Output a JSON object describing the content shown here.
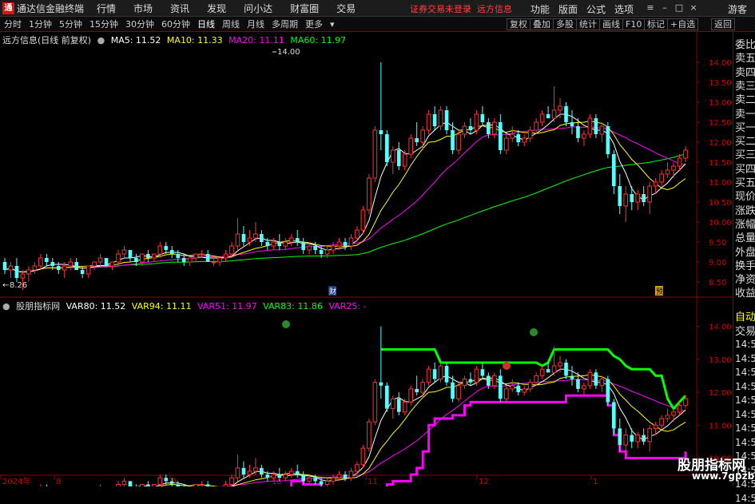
{
  "topbar": {
    "logo": "通",
    "app_title": "通达信金融终端",
    "menu": [
      "行情",
      "市场",
      "资讯",
      "发现",
      "问小达",
      "财富圈",
      "交易"
    ],
    "warning": "证券交易未登录",
    "warning_tail": "远方信息",
    "right_items": [
      "功能",
      "版面",
      "公式",
      "选项"
    ],
    "guest": "游客"
  },
  "toolbar": {
    "periods": [
      "分时",
      "1分钟",
      "5分钟",
      "15分钟",
      "30分钟",
      "60分钟",
      "日线",
      "周线",
      "月线",
      "多周期",
      "更多"
    ],
    "active_period": "日线",
    "buttons": [
      "复权",
      "叠加",
      "多股",
      "统计",
      "画线",
      "F10",
      "标记",
      "+自选",
      "返回"
    ]
  },
  "main_chart": {
    "title": "远方信息(日线 前复权)",
    "ma5": "MA5: 11.52",
    "ma10": "MA10: 11.33",
    "ma20": "MA20: 11.11",
    "ma60": "MA60: 11.97",
    "high_label": "14.00",
    "low_label": "8.26",
    "marker_cai": "财",
    "marker_yue": "预",
    "y_ticks": [
      "14.00",
      "13.50",
      "13.00",
      "12.50",
      "12.00",
      "11.50",
      "11.00",
      "10.50",
      "10.00",
      "9.50",
      "9.00",
      "8.50"
    ]
  },
  "sub_chart": {
    "title": "股朋指标网",
    "var80": "VAR80: 11.52",
    "var94": "VAR94: 11.11",
    "var51": "VAR51: 11.97",
    "var83": "VAR83: 11.86",
    "var25": "VAR25: -",
    "y_ticks": [
      "14.00",
      "13.00",
      "12.00",
      "11.00",
      "10.00"
    ]
  },
  "x_axis": [
    "2024年",
    "8",
    "9",
    "10",
    "11",
    "12",
    "1"
  ],
  "right_panel": {
    "top_items": [
      "委比",
      "卖五",
      "卖四",
      "卖三",
      "卖二",
      "卖一",
      "买一",
      "买二",
      "买三",
      "买四",
      "买五",
      "现价",
      "涨跌",
      "涨幅",
      "总量",
      "外盘",
      "换手",
      "净资",
      "收益"
    ],
    "bottom_head": [
      "自动",
      "交易"
    ],
    "time_rows": [
      "14:5",
      "14:5",
      "14:5",
      "14:5",
      "14:5",
      "14:5",
      "14:5",
      "14:5",
      "14:5",
      "14:5",
      "14:5",
      "14:5"
    ]
  },
  "watermark": {
    "line1": "股朋指标网",
    "line2": "www.7gpzb.com"
  },
  "colors": {
    "up": "#ff3232",
    "down": "#54ffff",
    "ma5": "#ffffff",
    "ma10": "#ffff00",
    "ma20": "#ff00ff",
    "ma60": "#00ff00",
    "var51": "#00ff00",
    "var83": "#ff00ff"
  },
  "chart_data": {
    "type": "candlestick",
    "title": "远方信息(日线 前复权)",
    "x_labels": [
      "2024年",
      "8",
      "9",
      "10",
      "11",
      "12",
      "1"
    ],
    "price_range": [
      8.26,
      14.0
    ],
    "main_ylim": [
      8.2,
      14.4
    ],
    "sub_ylim": [
      9.6,
      14.5
    ],
    "candles": [
      [
        9.0,
        9.1,
        8.7,
        8.8
      ],
      [
        8.8,
        9.0,
        8.6,
        8.9
      ],
      [
        8.9,
        9.1,
        8.5,
        8.6
      ],
      [
        8.6,
        8.8,
        8.3,
        8.7
      ],
      [
        8.7,
        8.9,
        8.5,
        8.8
      ],
      [
        8.8,
        9.0,
        8.7,
        8.9
      ],
      [
        8.9,
        9.2,
        8.8,
        9.1
      ],
      [
        9.1,
        9.2,
        8.9,
        9.0
      ],
      [
        9.0,
        9.1,
        8.8,
        8.9
      ],
      [
        8.9,
        9.0,
        8.7,
        8.8
      ],
      [
        8.8,
        9.0,
        8.6,
        8.9
      ],
      [
        8.9,
        9.1,
        8.8,
        9.0
      ],
      [
        9.0,
        9.1,
        8.8,
        8.8
      ],
      [
        8.8,
        8.9,
        8.6,
        8.7
      ],
      [
        8.7,
        8.9,
        8.6,
        8.9
      ],
      [
        8.9,
        9.0,
        8.8,
        9.0
      ],
      [
        9.0,
        9.2,
        8.9,
        9.1
      ],
      [
        9.1,
        9.1,
        8.9,
        8.9
      ],
      [
        8.9,
        9.0,
        8.8,
        9.0
      ],
      [
        9.0,
        9.3,
        8.9,
        9.2
      ],
      [
        9.2,
        9.4,
        9.1,
        9.3
      ],
      [
        9.3,
        9.3,
        9.0,
        9.1
      ],
      [
        9.1,
        9.2,
        8.9,
        9.0
      ],
      [
        9.0,
        9.2,
        8.9,
        9.2
      ],
      [
        9.2,
        9.3,
        9.0,
        9.1
      ],
      [
        9.1,
        9.2,
        9.0,
        9.2
      ],
      [
        9.2,
        9.5,
        9.1,
        9.4
      ],
      [
        9.4,
        9.5,
        9.2,
        9.3
      ],
      [
        9.3,
        9.4,
        9.1,
        9.2
      ],
      [
        9.2,
        9.3,
        9.0,
        9.1
      ],
      [
        9.1,
        9.2,
        8.9,
        9.0
      ],
      [
        9.0,
        9.1,
        8.9,
        9.1
      ],
      [
        9.1,
        9.2,
        9.0,
        9.2
      ],
      [
        9.2,
        9.3,
        9.1,
        9.2
      ],
      [
        9.2,
        9.3,
        9.0,
        9.0
      ],
      [
        9.0,
        9.1,
        8.9,
        9.0
      ],
      [
        9.0,
        9.1,
        8.9,
        9.1
      ],
      [
        9.1,
        9.3,
        9.0,
        9.2
      ],
      [
        9.2,
        9.5,
        9.1,
        9.4
      ],
      [
        9.4,
        10.1,
        9.3,
        9.7
      ],
      [
        9.7,
        9.9,
        9.4,
        9.5
      ],
      [
        9.5,
        9.8,
        9.4,
        9.6
      ],
      [
        9.6,
        10.0,
        9.5,
        9.7
      ],
      [
        9.7,
        9.8,
        9.4,
        9.5
      ],
      [
        9.5,
        9.6,
        9.3,
        9.4
      ],
      [
        9.4,
        9.6,
        9.3,
        9.5
      ],
      [
        9.5,
        9.7,
        9.3,
        9.4
      ],
      [
        9.4,
        9.6,
        9.3,
        9.5
      ],
      [
        9.5,
        9.7,
        9.4,
        9.6
      ],
      [
        9.6,
        9.8,
        9.4,
        9.5
      ],
      [
        9.5,
        9.6,
        9.2,
        9.3
      ],
      [
        9.3,
        9.5,
        9.2,
        9.4
      ],
      [
        9.4,
        9.5,
        9.2,
        9.3
      ],
      [
        9.3,
        9.4,
        9.1,
        9.2
      ],
      [
        9.2,
        9.4,
        9.1,
        9.3
      ],
      [
        9.3,
        9.5,
        9.2,
        9.4
      ],
      [
        9.4,
        9.6,
        9.3,
        9.5
      ],
      [
        9.5,
        9.6,
        9.3,
        9.4
      ],
      [
        9.4,
        9.7,
        9.3,
        9.6
      ],
      [
        9.6,
        9.9,
        9.5,
        9.8
      ],
      [
        9.8,
        10.4,
        9.7,
        10.3
      ],
      [
        10.3,
        11.2,
        10.2,
        11.1
      ],
      [
        11.1,
        12.4,
        11.0,
        12.3
      ],
      [
        12.3,
        14.0,
        11.8,
        12.2
      ],
      [
        12.2,
        12.3,
        11.4,
        11.5
      ],
      [
        11.5,
        11.9,
        11.2,
        11.8
      ],
      [
        11.8,
        12.0,
        11.3,
        11.4
      ],
      [
        11.4,
        11.8,
        11.3,
        11.7
      ],
      [
        11.7,
        12.2,
        11.6,
        12.1
      ],
      [
        12.1,
        12.5,
        11.9,
        12.0
      ],
      [
        12.0,
        12.4,
        11.8,
        12.3
      ],
      [
        12.3,
        12.8,
        12.2,
        12.7
      ],
      [
        12.7,
        12.9,
        12.3,
        12.4
      ],
      [
        12.4,
        12.9,
        12.3,
        12.8
      ],
      [
        12.8,
        12.9,
        12.2,
        12.3
      ],
      [
        12.3,
        12.5,
        11.7,
        11.8
      ],
      [
        11.8,
        12.3,
        11.7,
        12.2
      ],
      [
        12.2,
        12.5,
        12.1,
        12.4
      ],
      [
        12.4,
        12.6,
        12.2,
        12.3
      ],
      [
        12.3,
        12.8,
        12.2,
        12.7
      ],
      [
        12.7,
        12.9,
        12.4,
        12.5
      ],
      [
        12.5,
        12.6,
        12.1,
        12.2
      ],
      [
        12.2,
        12.6,
        12.1,
        12.5
      ],
      [
        12.5,
        12.7,
        11.7,
        11.8
      ],
      [
        11.8,
        12.2,
        11.7,
        12.1
      ],
      [
        12.1,
        12.4,
        12.0,
        12.2
      ],
      [
        12.2,
        12.3,
        11.9,
        12.0
      ],
      [
        12.0,
        12.2,
        11.9,
        12.1
      ],
      [
        12.1,
        12.4,
        12.0,
        12.3
      ],
      [
        12.3,
        12.6,
        12.2,
        12.5
      ],
      [
        12.5,
        12.8,
        12.4,
        12.7
      ],
      [
        12.7,
        12.9,
        12.6,
        12.6
      ],
      [
        12.6,
        13.4,
        12.5,
        12.8
      ],
      [
        12.8,
        13.1,
        12.6,
        12.9
      ],
      [
        12.9,
        13.0,
        12.4,
        12.5
      ],
      [
        12.5,
        12.8,
        12.2,
        12.4
      ],
      [
        12.4,
        12.6,
        12.0,
        12.1
      ],
      [
        12.1,
        12.3,
        11.9,
        12.2
      ],
      [
        12.2,
        12.7,
        12.1,
        12.6
      ],
      [
        12.6,
        12.7,
        12.1,
        12.2
      ],
      [
        12.2,
        12.5,
        12.0,
        12.4
      ],
      [
        12.4,
        12.5,
        11.6,
        11.7
      ],
      [
        11.7,
        11.8,
        10.7,
        10.9
      ],
      [
        10.9,
        11.2,
        10.2,
        10.4
      ],
      [
        10.4,
        10.9,
        10.0,
        10.7
      ],
      [
        10.7,
        10.9,
        10.3,
        10.5
      ],
      [
        10.5,
        10.8,
        10.3,
        10.7
      ],
      [
        10.7,
        10.9,
        10.4,
        10.5
      ],
      [
        10.5,
        11.0,
        10.2,
        10.9
      ],
      [
        10.9,
        11.1,
        10.7,
        11.0
      ],
      [
        11.0,
        11.3,
        10.9,
        11.2
      ],
      [
        11.2,
        11.5,
        11.1,
        11.3
      ],
      [
        11.3,
        11.5,
        11.1,
        11.4
      ],
      [
        11.4,
        11.7,
        11.3,
        11.6
      ],
      [
        11.6,
        11.9,
        11.5,
        11.8
      ]
    ]
  }
}
